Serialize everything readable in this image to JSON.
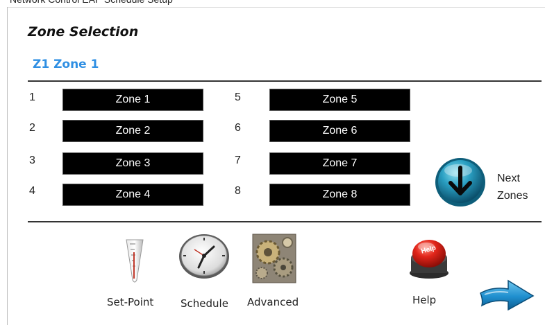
{
  "window": {
    "title_partial": "Network Control EAP Schedule Setup"
  },
  "page": {
    "title": "Zone Selection",
    "current_zone": "Z1 Zone 1"
  },
  "zones": [
    {
      "num": "1",
      "label": "Zone 1"
    },
    {
      "num": "2",
      "label": "Zone 2"
    },
    {
      "num": "3",
      "label": "Zone 3"
    },
    {
      "num": "4",
      "label": "Zone 4"
    },
    {
      "num": "5",
      "label": "Zone 5"
    },
    {
      "num": "6",
      "label": "Zone 6"
    },
    {
      "num": "7",
      "label": "Zone 7"
    },
    {
      "num": "8",
      "label": "Zone 8"
    }
  ],
  "next_zones": {
    "line1": "Next",
    "line2": "Zones",
    "icon": "arrow-down-circle-icon"
  },
  "toolbar": {
    "setpoint_label": "Set-Point",
    "schedule_label": "Schedule",
    "advanced_label": "Advanced",
    "help_label": "Help",
    "help_icon_text": "Help"
  },
  "colors": {
    "accent_blue": "#2f8fe3",
    "zone_button_bg": "#000000",
    "zone_button_text": "#ffffff",
    "help_red": "#d9221b"
  }
}
